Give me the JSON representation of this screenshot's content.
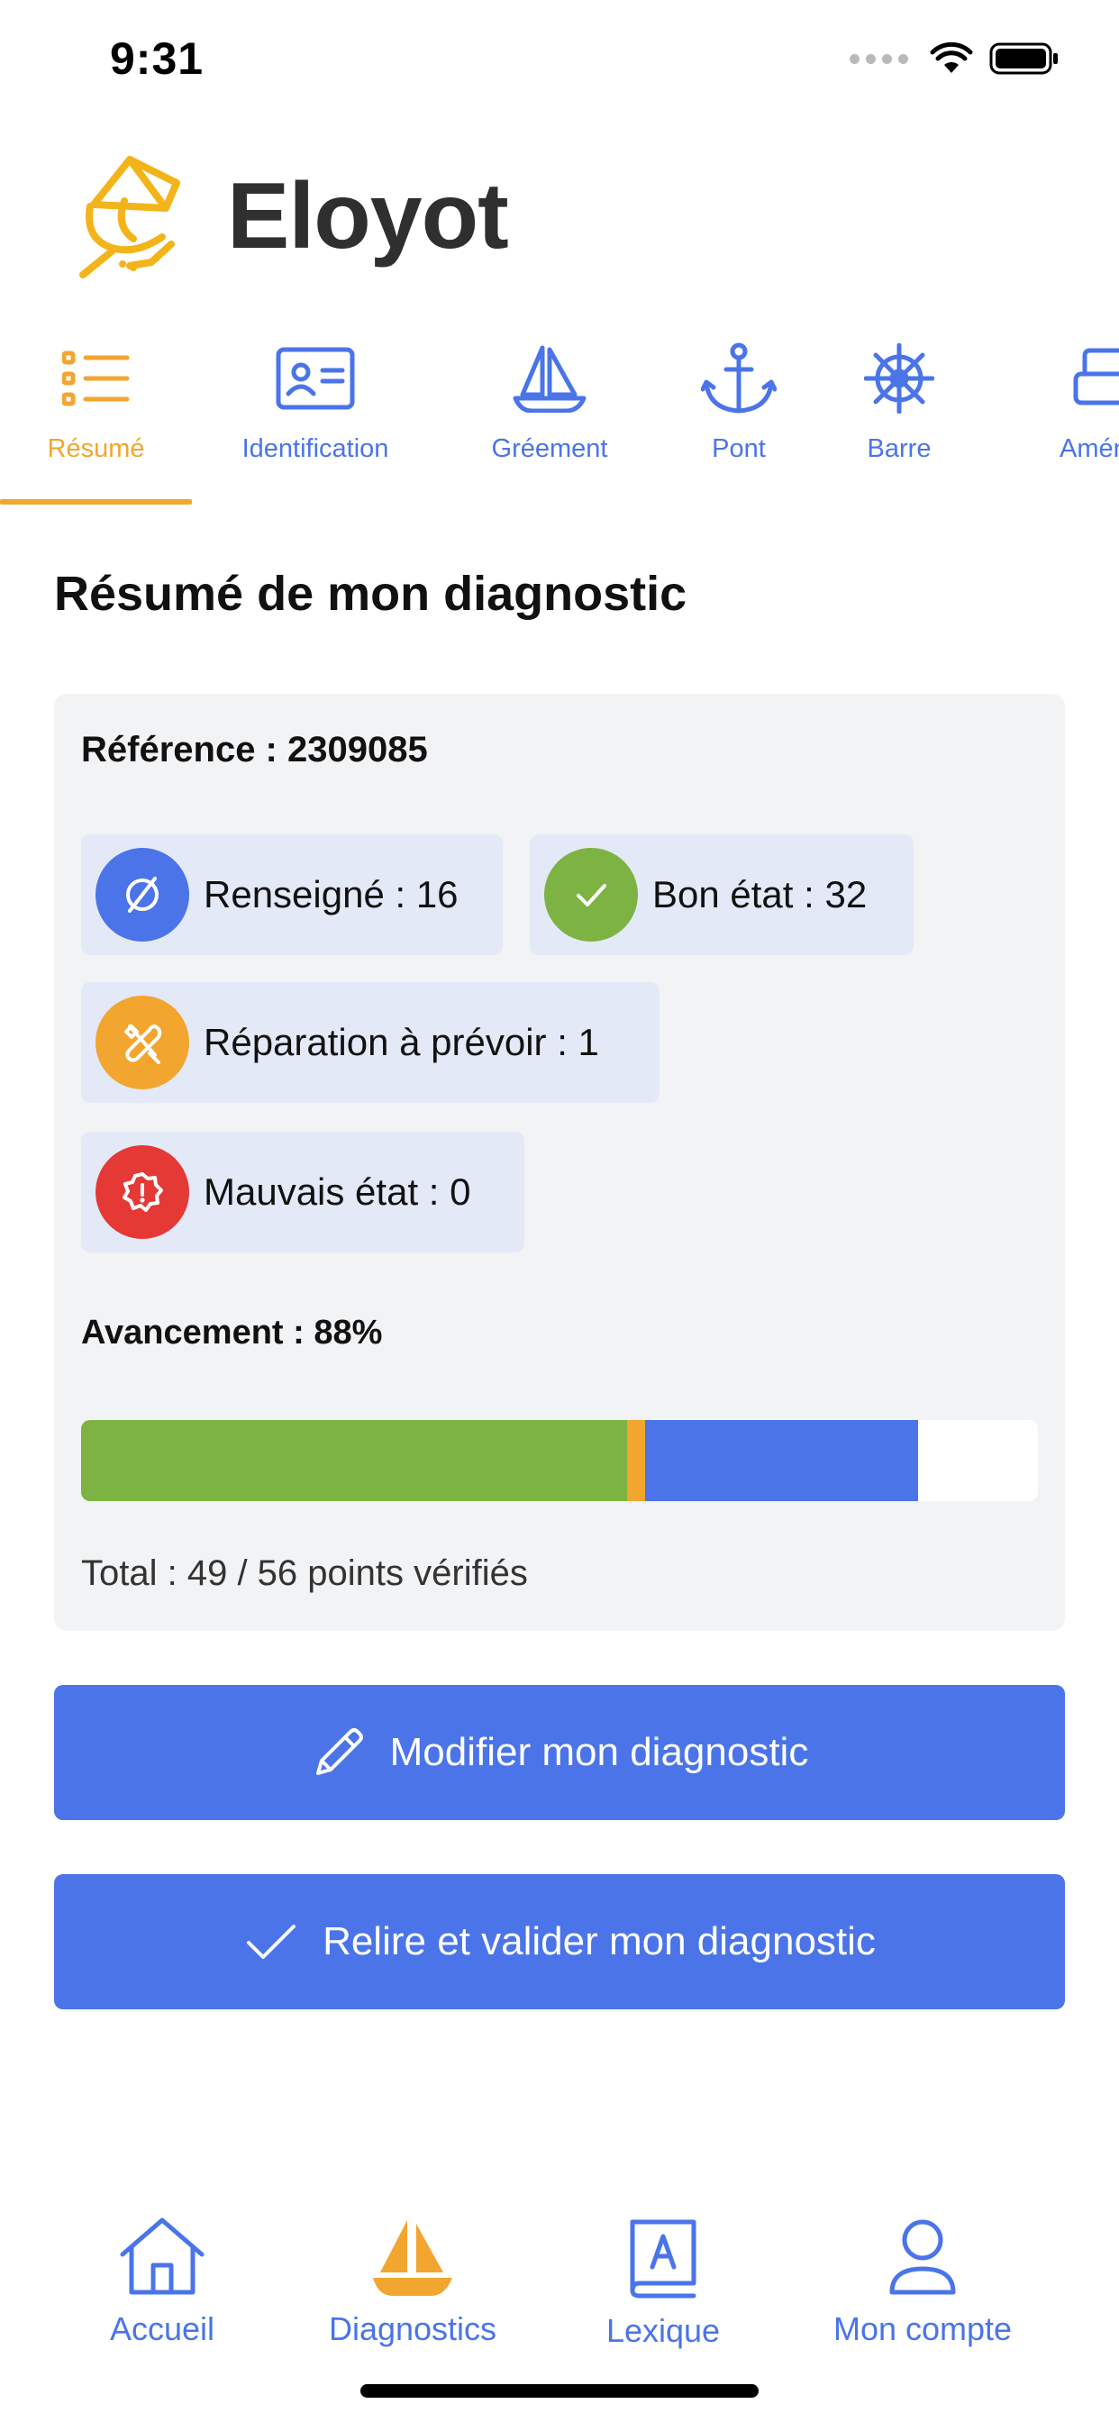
{
  "status_bar": {
    "time": "9:31"
  },
  "app": {
    "title": "Eloyot"
  },
  "tabs": [
    {
      "label": "Résumé",
      "icon": "list-icon",
      "active": true
    },
    {
      "label": "Identification",
      "icon": "id-card-icon",
      "active": false
    },
    {
      "label": "Gréement",
      "icon": "sailboat-icon",
      "active": false
    },
    {
      "label": "Pont",
      "icon": "anchor-icon",
      "active": false
    },
    {
      "label": "Barre",
      "icon": "helm-wheel-icon",
      "active": false
    },
    {
      "label": "Aménag",
      "icon": "furniture-icon",
      "active": false
    }
  ],
  "section": {
    "title": "Résumé de mon diagnostic"
  },
  "summary": {
    "reference": "Référence : 2309085",
    "stats": [
      {
        "label": "Renseigné : 16",
        "value": 16,
        "icon": "not-applicable-icon",
        "color": "#4a74e8"
      },
      {
        "label": "Bon état : 32",
        "value": 32,
        "icon": "check-icon",
        "color": "#7cb342"
      },
      {
        "label": "Réparation à prévoir : 1",
        "value": 1,
        "icon": "tools-icon",
        "color": "#f2a52f"
      },
      {
        "label": "Mauvais état : 0",
        "value": 0,
        "icon": "warning-badge-icon",
        "color": "#e53935"
      }
    ],
    "progress_label": "Avancement : 88%",
    "progress_percent": 88,
    "progress_segments": [
      {
        "name": "bon-etat",
        "fraction": 0.571,
        "color": "#7cb342"
      },
      {
        "name": "reparation",
        "fraction": 0.018,
        "color": "#f2a52f"
      },
      {
        "name": "renseigne",
        "fraction": 0.286,
        "color": "#4a74e8"
      }
    ],
    "total": "Total : 49 / 56 points vérifiés"
  },
  "buttons": {
    "modify": {
      "label": "Modifier mon diagnostic",
      "icon": "pencil-icon"
    },
    "validate": {
      "label": "Relire et valider mon diagnostic",
      "icon": "check-icon"
    }
  },
  "bottom_nav": [
    {
      "label": "Accueil",
      "icon": "home-icon",
      "active": false
    },
    {
      "label": "Diagnostics",
      "icon": "sailboat-filled-icon",
      "active": true
    },
    {
      "label": "Lexique",
      "icon": "dictionary-icon",
      "active": false
    },
    {
      "label": "Mon compte",
      "icon": "user-icon",
      "active": false
    }
  ],
  "colors": {
    "accent": "#4a74e8",
    "active": "#f2a52f",
    "good": "#7cb342",
    "bad": "#e53935"
  }
}
